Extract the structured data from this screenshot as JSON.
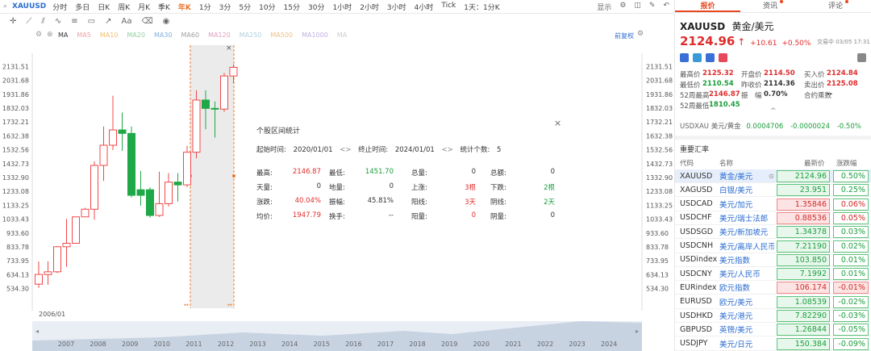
{
  "toolbar": {
    "symbol": "XAUUSD",
    "timeframes": [
      "分时",
      "多日",
      "日K",
      "周K",
      "月K",
      "季K",
      "年K",
      "1分",
      "3分",
      "5分",
      "10分",
      "15分",
      "30分",
      "1小时",
      "2小时",
      "3小时",
      "4小时",
      "Tick",
      "1天：1分K"
    ],
    "active_timeframe": "年K",
    "display_label": "显示",
    "font_label": "Aa",
    "restore_label": "前复权"
  },
  "ma_legend": [
    "MA",
    "MA5",
    "MA10",
    "MA20",
    "MA30",
    "MA60",
    "MA120",
    "MA250",
    "MA500",
    "MA1000",
    "MA"
  ],
  "y_axis_left": [
    "2131.51",
    "2031.68",
    "1931.86",
    "1832.03",
    "1732.21",
    "1632.38",
    "1532.56",
    "1432.73",
    "1332.90",
    "1233.08",
    "1133.25",
    "1033.43",
    "933.60",
    "833.78",
    "733.95",
    "634.13",
    "534.30"
  ],
  "y_axis_right": [
    "2131.51",
    "2031.68",
    "1931.86",
    "1832.03",
    "1732.21",
    "1632.38",
    "1532.56",
    "1432.73",
    "1332.90",
    "1233.08",
    "1133.25",
    "1033.43",
    "933.60",
    "833.78",
    "733.95",
    "634.13",
    "534.30"
  ],
  "start_label": "2006/01",
  "x_axis": [
    "2007",
    "2008",
    "2009",
    "2010",
    "2011",
    "2012",
    "2013",
    "2014",
    "2015",
    "2016",
    "2017",
    "2018",
    "2019",
    "2020",
    "2021",
    "2022",
    "2023",
    "2024"
  ],
  "chart_data": {
    "type": "candlestick",
    "ylim": [
      480,
      2180
    ],
    "candles": [
      {
        "o": 566,
        "h": 729,
        "l": 540,
        "c": 636,
        "up": true
      },
      {
        "o": 635,
        "h": 730,
        "l": 561,
        "c": 655,
        "up": true
      },
      {
        "o": 655,
        "h": 841,
        "l": 645,
        "c": 835,
        "up": true
      },
      {
        "o": 835,
        "h": 1035,
        "l": 690,
        "c": 860,
        "up": true
      },
      {
        "o": 860,
        "h": 1050,
        "l": 860,
        "c": 1050,
        "up": true
      },
      {
        "o": 1050,
        "h": 1115,
        "l": 1050,
        "c": 1105,
        "up": true
      },
      {
        "o": 1105,
        "h": 1450,
        "l": 1030,
        "c": 1420,
        "up": true
      },
      {
        "o": 1420,
        "h": 1700,
        "l": 1308,
        "c": 1565,
        "up": true
      },
      {
        "o": 1565,
        "h": 1921,
        "l": 1530,
        "c": 1675,
        "up": true
      },
      {
        "o": 1675,
        "h": 1800,
        "l": 1525,
        "c": 1650,
        "up": false
      },
      {
        "o": 1650,
        "h": 1700,
        "l": 1190,
        "c": 1205,
        "up": false
      },
      {
        "o": 1205,
        "h": 1380,
        "l": 1130,
        "c": 1245,
        "up": false
      },
      {
        "o": 1245,
        "h": 1262,
        "l": 1045,
        "c": 1060,
        "up": false
      },
      {
        "o": 1060,
        "h": 1375,
        "l": 1050,
        "c": 1145,
        "up": true
      },
      {
        "o": 1145,
        "h": 1365,
        "l": 1125,
        "c": 1300,
        "up": true
      },
      {
        "o": 1300,
        "h": 1365,
        "l": 1160,
        "c": 1280,
        "up": false
      },
      {
        "o": 1280,
        "h": 1560,
        "l": 1265,
        "c": 1515,
        "up": true
      },
      {
        "o": 1515,
        "h": 1960,
        "l": 1470,
        "c": 1890,
        "up": true
      },
      {
        "o": 1890,
        "h": 1960,
        "l": 1680,
        "c": 1830,
        "up": false
      },
      {
        "o": 1830,
        "h": 1880,
        "l": 1620,
        "c": 1825,
        "up": false
      },
      {
        "o": 1825,
        "h": 2085,
        "l": 1805,
        "c": 2063,
        "up": true
      },
      {
        "o": 2063,
        "h": 2147,
        "l": 2010,
        "c": 2125,
        "up": true
      }
    ]
  },
  "stats": {
    "title": "个股区间统计",
    "start_label": "起始时间:",
    "start_value": "2020/01/01",
    "end_label": "终止时间:",
    "end_value": "2024/01/01",
    "count_label": "统计个数:",
    "count_value": "5",
    "rows": [
      [
        [
          "最高:",
          "2146.87",
          "red"
        ],
        [
          "最低:",
          "1451.70",
          "green"
        ],
        [
          "总量:",
          "0",
          ""
        ],
        [
          "总额:",
          "0",
          ""
        ]
      ],
      [
        [
          "天量:",
          "0",
          ""
        ],
        [
          "地量:",
          "0",
          ""
        ],
        [
          "上涨:",
          "3根",
          "red"
        ],
        [
          "下跌:",
          "2根",
          "green"
        ]
      ],
      [
        [
          "涨跌:",
          "40.04%",
          "red"
        ],
        [
          "振幅:",
          "45.81%",
          ""
        ],
        [
          "阳线:",
          "3天",
          "red"
        ],
        [
          "阴线:",
          "2天",
          "green"
        ]
      ],
      [
        [
          "均价:",
          "1947.79",
          "red"
        ],
        [
          "换手:",
          "--",
          ""
        ],
        [
          "阳量:",
          "0",
          "red"
        ],
        [
          "阴量:",
          "0",
          ""
        ]
      ]
    ]
  },
  "panel": {
    "tabs": [
      "报价",
      "资讯",
      "评论"
    ],
    "symbol": "XAUUSD",
    "name": "黄金/美元",
    "price": "2124.96",
    "arrow": "↑",
    "change": "+10.61",
    "change_pct": "+0.50%",
    "trade_time": "交易中 03/05 17:31",
    "quotes": [
      [
        [
          "最高价",
          "2125.32",
          "red"
        ],
        [
          "开盘价",
          "2114.50",
          "red"
        ],
        [
          "买入价",
          "2124.84",
          "red"
        ]
      ],
      [
        [
          "最低价",
          "2110.54",
          "green"
        ],
        [
          "昨收价",
          "2114.36",
          ""
        ],
        [
          "卖出价",
          "2125.08",
          "red"
        ]
      ],
      [
        [
          "52周最高",
          "2146.87",
          "red"
        ],
        [
          "振　幅",
          "0.70%",
          ""
        ],
        [
          "合约乘数",
          "--",
          ""
        ]
      ],
      [
        [
          "52周最低",
          "1810.45",
          "green"
        ],
        [
          "",
          "",
          ""
        ],
        [
          "",
          "",
          ""
        ]
      ]
    ],
    "related": {
      "code": "USDXAU",
      "name": "美元/黄金",
      "price": "0.0004706",
      "change": "-0.0000024",
      "pct": "-0.50%"
    },
    "section_title": "重要汇率",
    "columns": [
      "代码",
      "名称",
      "最新价",
      "涨跌幅"
    ],
    "rows": [
      {
        "code": "XAUUSD",
        "name": "黄金/美元",
        "price": "2124.96",
        "pct": "0.50%",
        "dir": "up"
      },
      {
        "code": "XAGUSD",
        "name": "白银/美元",
        "price": "23.951",
        "pct": "0.25%",
        "dir": "up"
      },
      {
        "code": "USDCAD",
        "name": "美元/加元",
        "price": "1.35846",
        "pct": "0.06%",
        "dir": "down"
      },
      {
        "code": "USDCHF",
        "name": "美元/瑞士法郎",
        "price": "0.88536",
        "pct": "0.05%",
        "dir": "down"
      },
      {
        "code": "USDSGD",
        "name": "美元/新加坡元",
        "price": "1.34378",
        "pct": "0.03%",
        "dir": "up"
      },
      {
        "code": "USDCNH",
        "name": "美元/离岸人民币",
        "price": "7.21190",
        "pct": "0.02%",
        "dir": "up"
      },
      {
        "code": "USDindex",
        "name": "美元指数",
        "price": "103.850",
        "pct": "0.01%",
        "dir": "up"
      },
      {
        "code": "USDCNY",
        "name": "美元/人民币",
        "price": "7.1992",
        "pct": "0.01%",
        "dir": "up"
      },
      {
        "code": "EURindex",
        "name": "欧元指数",
        "price": "106.174",
        "pct": "-0.01%",
        "dir": "down"
      },
      {
        "code": "EURUSD",
        "name": "欧元/美元",
        "price": "1.08539",
        "pct": "-0.02%",
        "dir": "up"
      },
      {
        "code": "USDHKD",
        "name": "美元/港元",
        "price": "7.82290",
        "pct": "-0.03%",
        "dir": "up"
      },
      {
        "code": "GBPUSD",
        "name": "英镑/美元",
        "price": "1.26844",
        "pct": "-0.05%",
        "dir": "up"
      },
      {
        "code": "USDJPY",
        "name": "美元/日元",
        "price": "150.384",
        "pct": "-0.09%",
        "dir": "up"
      }
    ]
  }
}
